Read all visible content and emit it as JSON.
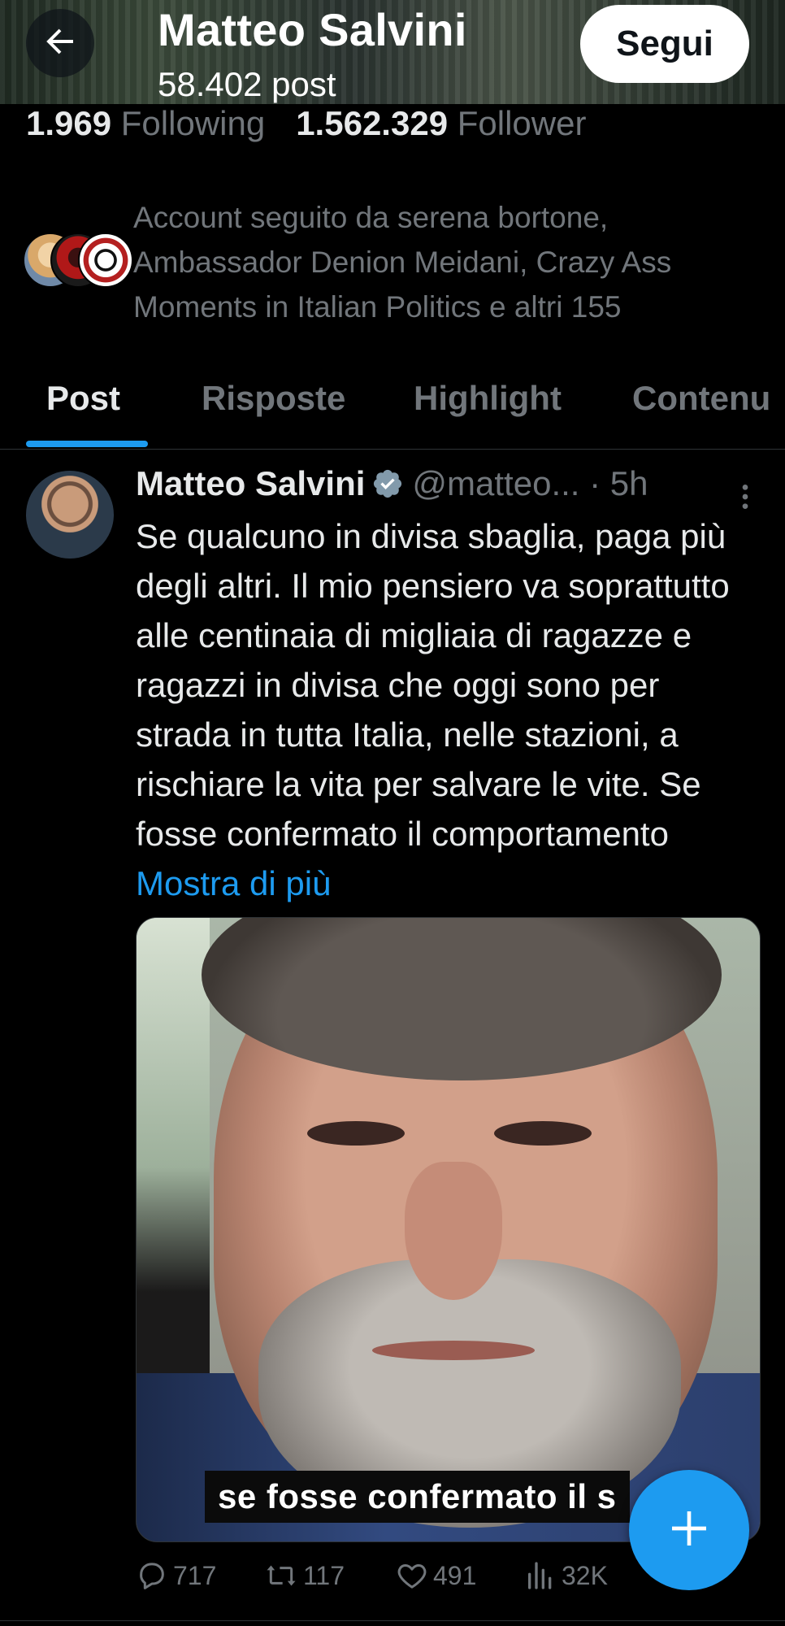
{
  "header": {
    "name": "Matteo Salvini",
    "post_count": "58.402 post",
    "follow_label": "Segui"
  },
  "stats": {
    "following_count": "1.969",
    "following_label": "Following",
    "followers_count": "1.562.329",
    "followers_label": "Follower"
  },
  "followed_by": {
    "text": "Account seguito da serena bortone, Ambassador Denion Meidani, Crazy Ass Moments in Italian Politics e altri 155"
  },
  "tabs": [
    "Post",
    "Risposte",
    "Highlight",
    "Contenu"
  ],
  "tweet": {
    "name": "Matteo Salvini",
    "handle": "@matteo...",
    "dot": "·",
    "time": "5h",
    "text": "Se qualcuno in divisa sbaglia, paga più degli altri. Il mio pensiero va soprattutto alle centinaia di migliaia di ragazze e ragazzi in divisa che oggi sono per strada in tutta Italia, nelle stazioni, a rischiare la vita per salvare le vite. Se fosse confermato il comportamento",
    "more_label": "Mostra di più",
    "video_caption": "se fosse confermato il s",
    "replies": "717",
    "reposts": "117",
    "likes": "491",
    "views": "32K"
  },
  "colors": {
    "accent": "#1d9bf0",
    "background": "#000000",
    "muted": "#71767b",
    "text": "#e7e9ea"
  },
  "icons": {
    "back": "arrow-left-icon",
    "verified": "verified-badge-icon",
    "more": "more-vertical-icon",
    "reply": "reply-icon",
    "repost": "repost-icon",
    "like": "heart-icon",
    "views": "views-icon",
    "compose": "plus-icon"
  }
}
